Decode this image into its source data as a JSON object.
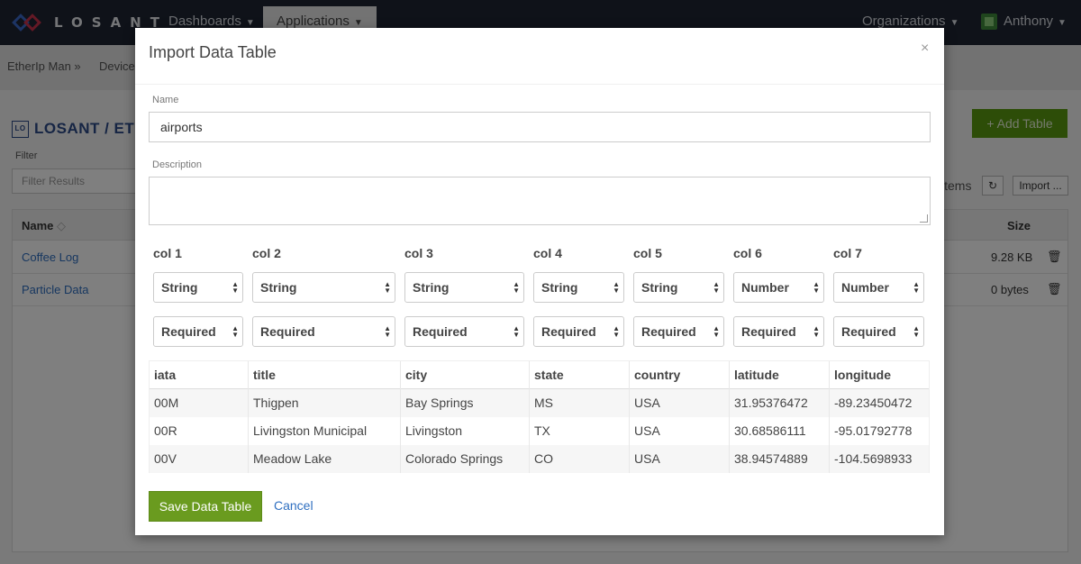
{
  "navbar": {
    "logo_text": "LOSANT",
    "dashboards": "Dashboards",
    "applications": "Applications",
    "organizations": "Organizations",
    "user": "Anthony"
  },
  "background": {
    "breadcrumb_1": "EtherIp Man »",
    "breadcrumb_2": "Device",
    "title_prefix": "LO",
    "title": "LOSANT / ETHER",
    "filter_label": "Filter",
    "filter_placeholder": "Filter Results",
    "add_table": "+ Add Table",
    "items_label": "items",
    "refresh": "↻",
    "import": "Import ...",
    "table_headers": {
      "name": "Name",
      "sort": "◇",
      "size": "Size"
    },
    "rows": [
      {
        "name": "Coffee Log",
        "size": "9.28 KB"
      },
      {
        "name": "Particle Data",
        "size": "0 bytes"
      }
    ]
  },
  "modal": {
    "title": "Import Data Table",
    "close": "×",
    "name_label": "Name",
    "name_value": "airports",
    "description_label": "Description",
    "description_value": "",
    "columns": [
      {
        "label": "col 1",
        "type": "String",
        "required": "Required"
      },
      {
        "label": "col 2",
        "type": "String",
        "required": "Required"
      },
      {
        "label": "col 3",
        "type": "String",
        "required": "Required"
      },
      {
        "label": "col 4",
        "type": "String",
        "required": "Required"
      },
      {
        "label": "col 5",
        "type": "String",
        "required": "Required"
      },
      {
        "label": "col 6",
        "type": "Number",
        "required": "Required"
      },
      {
        "label": "col 7",
        "type": "Number",
        "required": "Required"
      }
    ],
    "preview_headers": [
      "iata",
      "title",
      "city",
      "state",
      "country",
      "latitude",
      "longitude"
    ],
    "preview_rows": [
      [
        "00M",
        "Thigpen",
        "Bay Springs",
        "MS",
        "USA",
        "31.95376472",
        "-89.23450472"
      ],
      [
        "00R",
        "Livingston Municipal",
        "Livingston",
        "TX",
        "USA",
        "30.68586111",
        "-95.01792778"
      ],
      [
        "00V",
        "Meadow Lake",
        "Colorado Springs",
        "CO",
        "USA",
        "38.94574889",
        "-104.5698933"
      ]
    ],
    "save_label": "Save Data Table",
    "cancel_label": "Cancel"
  }
}
